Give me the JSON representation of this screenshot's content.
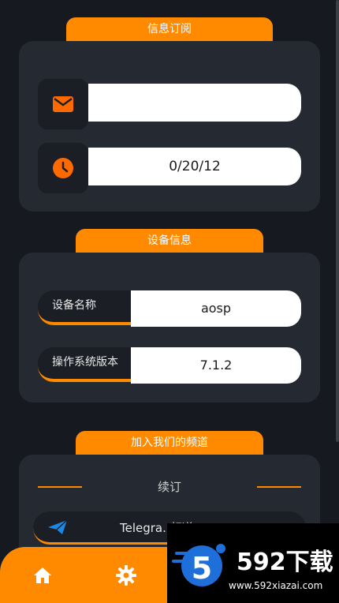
{
  "subscription": {
    "tab_label": "信息订阅",
    "email_value": "",
    "date_value": "0/20/12"
  },
  "device": {
    "tab_label": "设备信息",
    "name_label": "设备名称",
    "name_value": "aosp",
    "os_label": "操作系统版本",
    "os_value": "7.1.2"
  },
  "channel": {
    "tab_label": "加入我们的频道",
    "subtitle": "续订",
    "telegram_label": "Telegra..频道"
  },
  "watermark": {
    "brand": "592下载",
    "url": "www.592xiazai.com",
    "badge": "5"
  },
  "icons": {
    "mail": "mail-icon",
    "clock": "clock-icon",
    "telegram": "telegram-icon",
    "home": "home-icon",
    "settings": "gear-icon"
  },
  "colors": {
    "accent": "#ff8a00",
    "background": "#16191f",
    "card": "#252932"
  }
}
